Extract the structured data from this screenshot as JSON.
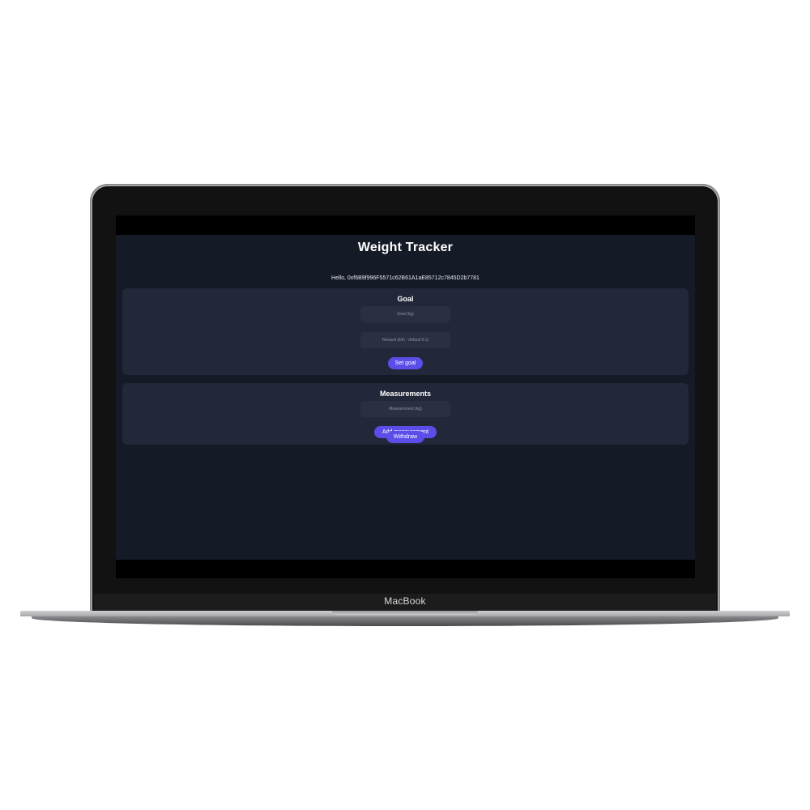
{
  "device": {
    "brand_label": "MacBook"
  },
  "app": {
    "title": "Weight Tracker",
    "greeting": "Hello, 0xf6B9f996F5571c62B61A1aE85712c7845D2b7781",
    "background": "#151a27",
    "card_color": "#222839",
    "accent_color": "#5b4ee8"
  },
  "goal_section": {
    "title": "Goal",
    "goal_input": {
      "placeholder": "Goal (kg)",
      "value": ""
    },
    "reward_input": {
      "placeholder": "Reward (Eth - default 0.1)",
      "value": ""
    },
    "set_goal_label": "Set goal"
  },
  "measurements_section": {
    "title": "Measurements",
    "measurement_input": {
      "placeholder": "Measurement (kg)",
      "value": ""
    },
    "add_measurement_label": "Add measurement"
  },
  "withdraw_label": "Withdraw"
}
